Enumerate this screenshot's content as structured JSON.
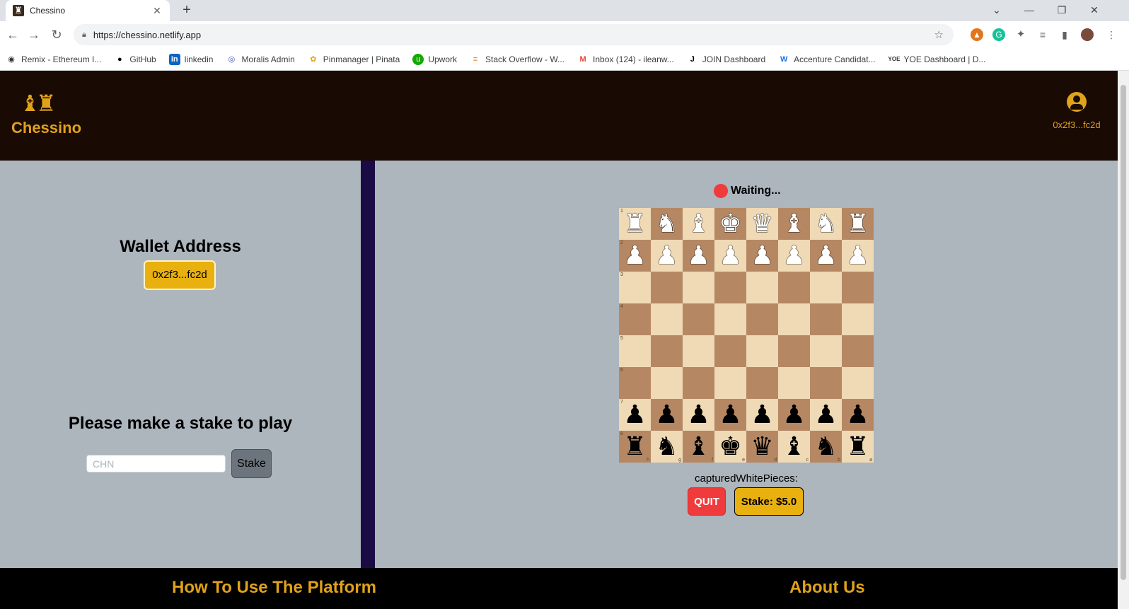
{
  "browser": {
    "tab_title": "Chessino",
    "tab_close": "✕",
    "new_tab": "+",
    "url": "https://chessino.netlify.app",
    "bookmarks": [
      {
        "label": "Remix - Ethereum I...",
        "icon": "remix-icon"
      },
      {
        "label": "GitHub",
        "icon": "github-icon"
      },
      {
        "label": "linkedin",
        "icon": "linkedin-icon"
      },
      {
        "label": "Moralis Admin",
        "icon": "moralis-icon"
      },
      {
        "label": "Pinmanager | Pinata",
        "icon": "pinata-icon"
      },
      {
        "label": "Upwork",
        "icon": "upwork-icon"
      },
      {
        "label": "Stack Overflow - W...",
        "icon": "stackoverflow-icon"
      },
      {
        "label": "Inbox (124) - ileanw...",
        "icon": "gmail-icon"
      },
      {
        "label": "JOIN Dashboard",
        "icon": "join-icon"
      },
      {
        "label": "Accenture Candidat...",
        "icon": "accenture-icon"
      },
      {
        "label": "YOE Dashboard | D...",
        "icon": "yoe-icon"
      }
    ]
  },
  "header": {
    "logo_text": "Chessino",
    "user_address": "0x2f3...fc2d"
  },
  "left": {
    "wallet_title": "Wallet Address",
    "wallet_value": "0x2f3...fc2d",
    "stake_title": "Please make a stake to play",
    "stake_placeholder": "CHN",
    "stake_button": "Stake"
  },
  "game": {
    "status": "Waiting...",
    "status_color": "#ef3b3b",
    "captured_label": "capturedWhitePieces:",
    "quit_button": "QUIT",
    "stake_display": "Stake: $5.0",
    "board": [
      [
        "R",
        "N",
        "B",
        "K",
        "Q",
        "B",
        "N",
        "R"
      ],
      [
        "P",
        "P",
        "P",
        "P",
        "P",
        "P",
        "P",
        "P"
      ],
      [
        "",
        "",
        "",
        "",
        "",
        "",
        "",
        ""
      ],
      [
        "",
        "",
        "",
        "",
        "",
        "",
        "",
        ""
      ],
      [
        "",
        "",
        "",
        "",
        "",
        "",
        "",
        ""
      ],
      [
        "",
        "",
        "",
        "",
        "",
        "",
        "",
        ""
      ],
      [
        "p",
        "p",
        "p",
        "p",
        "p",
        "p",
        "p",
        "p"
      ],
      [
        "r",
        "n",
        "b",
        "k",
        "q",
        "b",
        "n",
        "r"
      ]
    ],
    "rank_labels": [
      "1",
      "2",
      "3",
      "4",
      "5",
      "6",
      "7",
      "8"
    ],
    "file_labels": [
      "h",
      "g",
      "f",
      "e",
      "d",
      "c",
      "b",
      "a"
    ]
  },
  "footer": {
    "how_to": "How To Use The Platform",
    "about": "About Us"
  },
  "colors": {
    "accent": "#e0a21a",
    "header_bg": "#1a0a04",
    "panel_bg": "#adb5bd",
    "divider": "#1a0b45",
    "board_light": "#f0d9b5",
    "board_dark": "#b58863"
  }
}
